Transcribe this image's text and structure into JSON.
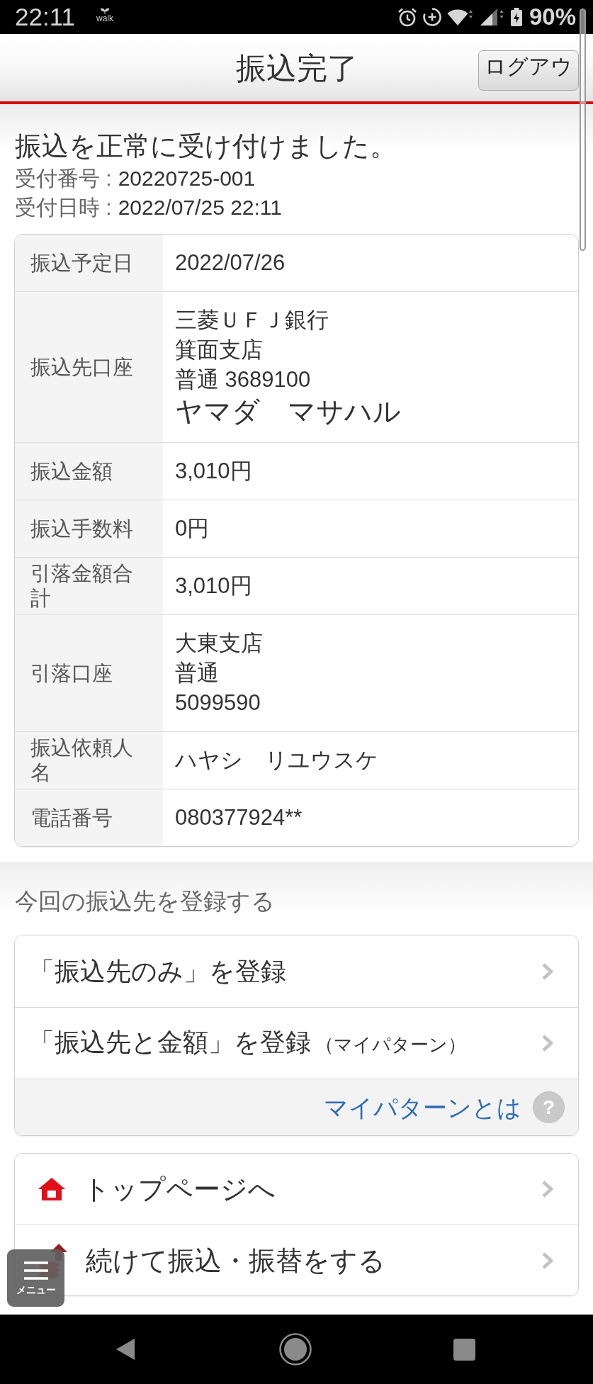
{
  "status_bar": {
    "time": "22:11",
    "app_label": "walk",
    "battery": "90%"
  },
  "header": {
    "title": "振込完了",
    "logout": "ログアウ"
  },
  "result": {
    "message": "振込を正常に受け付けました。",
    "details": [
      {
        "label": "受付番号 :",
        "value": "20220725-001"
      },
      {
        "label": "受付日時 :",
        "value": "2022/07/25 22:11"
      }
    ]
  },
  "transfer_table": {
    "rows": [
      {
        "label": "振込予定日",
        "lines": [
          {
            "text": "2022/07/26",
            "kind": "normal"
          }
        ]
      },
      {
        "label": "振込先口座",
        "lines": [
          {
            "text": "三菱ＵＦＪ銀行",
            "kind": "normal"
          },
          {
            "text": "箕面支店",
            "kind": "normal"
          },
          {
            "text": "普通 3689100",
            "kind": "normal"
          },
          {
            "text": "ヤマダ　マサハル",
            "kind": "name"
          }
        ]
      },
      {
        "label": "振込金額",
        "lines": [
          {
            "text": "3,010円",
            "kind": "normal"
          }
        ]
      },
      {
        "label": "振込手数料",
        "lines": [
          {
            "text": "0円",
            "kind": "normal"
          }
        ]
      },
      {
        "label": "引落金額合計",
        "lines": [
          {
            "text": "3,010円",
            "kind": "normal"
          }
        ]
      },
      {
        "label": "引落口座",
        "lines": [
          {
            "text": "大東支店",
            "kind": "normal"
          },
          {
            "text": "普通",
            "kind": "normal"
          },
          {
            "text": "5099590",
            "kind": "normal"
          }
        ]
      },
      {
        "label": "振込依頼人名",
        "lines": [
          {
            "text": "ハヤシ　リユウスケ",
            "kind": "normal"
          }
        ]
      },
      {
        "label": "電話番号",
        "lines": [
          {
            "text": "080377924**",
            "kind": "normal"
          }
        ]
      }
    ]
  },
  "register": {
    "heading": "今回の振込先を登録する",
    "options": [
      {
        "label": "「振込先のみ」を登録"
      },
      {
        "label": "「振込先と金額」を登録",
        "note": "（マイパターン）"
      }
    ],
    "help_link": "マイパターンとは",
    "help_mark": "?"
  },
  "links": [
    {
      "label": "トップページへ",
      "kind": "home"
    },
    {
      "label": "続けて振込・振替をする",
      "kind": "transfer"
    }
  ],
  "menu_button": {
    "label": "メニュー"
  }
}
